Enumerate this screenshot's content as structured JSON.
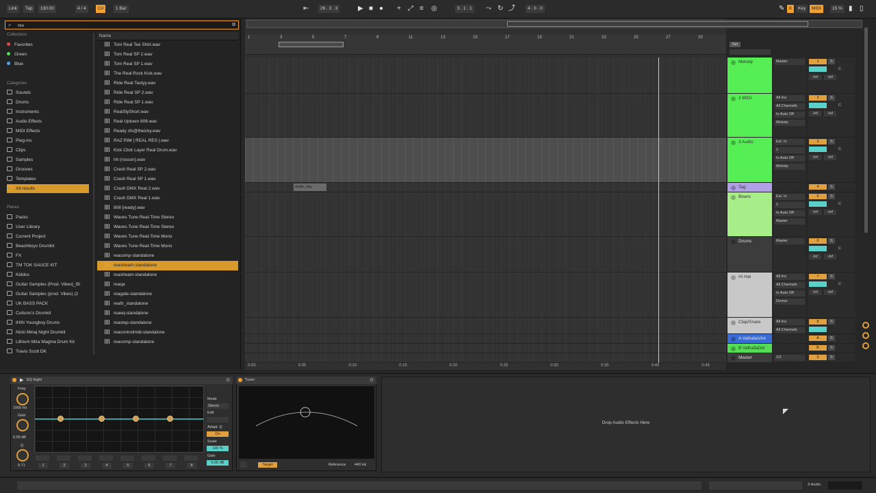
{
  "transport": {
    "link": "Link",
    "tap": "Tap",
    "tempo": "130.00",
    "time_sig": "4 / 4",
    "key_chip": "C#",
    "quantize": "1 Bar",
    "position": "26 . 3 . 3",
    "loop_start": "3 . 1 . 1",
    "loop_length": "4 . 0 . 0",
    "key_btn": "Key",
    "midi_btn": "MIDI",
    "cpu": "15 %"
  },
  "browser": {
    "search_value": "res",
    "collections_head": "Collections",
    "collections": [
      {
        "label": "Favorites",
        "color": "#e04a4a"
      },
      {
        "label": "Green",
        "color": "#5ad85a"
      },
      {
        "label": "Blue",
        "color": "#4aa8e8"
      }
    ],
    "categories_head": "Categories",
    "categories": [
      "Sounds",
      "Drums",
      "Instruments",
      "Audio Effects",
      "MIDI Effects",
      "Plug-ins",
      "Clips",
      "Samples",
      "Grooves",
      "Templates",
      "All results"
    ],
    "places_head": "Places",
    "places": [
      "Packs",
      "User Library",
      "Current Project",
      "Beachboys Drumkit",
      "FX",
      "TM TOK SAUCE KIT",
      "Kiddos",
      "Guitar Samples (Prod. Vibes)_Bl",
      "Guitar Samples (prod. Vibes) (2",
      "UK BASS PACK",
      "Cuttuno's Drumkit",
      "IHIN Youngboy Drums",
      "Nicki Minaj Night Drumkit",
      "Lithium Mira Magma Drum Kit",
      "Travis Scott DK"
    ],
    "name_head": "Name",
    "files": [
      "Tom Real Tee Shirt.wav",
      "Tom Real SP 2.wav",
      "Tom Real SP 1.wav",
      "The Real Rock Kick.wav",
      "Ride Real Tastyy.wav",
      "Ride Real SP 2.wav",
      "Ride Real SP 1.wav",
      "RealSlyShort.wav",
      "Real Uptown 808.wav",
      "Ready sfx@theicky.wav",
      "RAZ RIM | REAL RES |.wav",
      "Kick Click Layer Real Drum.wav",
      "hh (rosson).wav",
      "Crash Real SP 2.wav",
      "Crash Real SP 1.wav",
      "Crash DMX Real 2.wav",
      "Crash DMX Real 1.wav",
      "808 [ready].wav",
      "Waves Tune Real-Time Stereo",
      "Waves Tune Real-Time Stereo",
      "Waves Tune Real-Time Mono",
      "Waves Tune Real-Time Mono",
      "reacomp-standalone",
      "reastream-standalone",
      "reastream-standalone",
      "reaqa",
      "reagate-standalone",
      "reafir_standalone",
      "reaeq-standalone",
      "reastep-standalone",
      "reacontrolmidi-standalone",
      "reacomp-standalone"
    ]
  },
  "arrangement": {
    "bars": [
      "1",
      "3",
      "5",
      "7",
      "9",
      "11",
      "13",
      "15",
      "17",
      "19",
      "21",
      "23",
      "25",
      "27",
      "29"
    ],
    "times": [
      "0:00",
      "0:05",
      "0:10",
      "0:15",
      "0:20",
      "0:25",
      "0:30",
      "0:35",
      "0:40",
      "0:45"
    ],
    "locator": "audio_tag",
    "set_btn": "Set"
  },
  "tracks": [
    {
      "name": "Melody",
      "color": "#55ee55",
      "io": [
        "Master"
      ],
      "vol": "1",
      "pan": "C",
      "peak": "-Inf"
    },
    {
      "name": "2 MIDI",
      "color": "#55ee55",
      "io": [
        "All Ins",
        "All Channels",
        "In Auto Off",
        "Melody"
      ],
      "vol": "2",
      "pan": "C",
      "peak": "-Inf"
    },
    {
      "name": "3 Audio",
      "color": "#55ee55",
      "io": [
        "Ext. In",
        "1",
        "In Auto Off",
        "Melody"
      ],
      "vol": "3",
      "pan": "C",
      "peak": "-Inf"
    },
    {
      "name": "Tag",
      "color": "#b0a0e8",
      "io": [],
      "vol": "4",
      "pan": "",
      "peak": ""
    },
    {
      "name": "Bisers",
      "color": "#a8ee88",
      "io": [
        "Ext. In",
        "1",
        "In Auto Off",
        "Master"
      ],
      "vol": "5",
      "pan": "C",
      "peak": "-Inf"
    },
    {
      "name": "Drums",
      "color": "#3c3c3c",
      "io": [
        "Master"
      ],
      "vol": "6",
      "pan": "C",
      "peak": "-Inf"
    },
    {
      "name": "Hi Hat",
      "color": "#c8c8c8",
      "io": [
        "All Ins",
        "All Channels",
        "In Auto Off",
        "Drums"
      ],
      "vol": "7",
      "pan": "C",
      "peak": "-Inf"
    },
    {
      "name": "Clap/Snare",
      "color": "#c8c8c8",
      "io": [
        "All Ins",
        "All Channels"
      ],
      "vol": "8",
      "pan": "",
      "peak": ""
    },
    {
      "name": "A ValhallaVint",
      "color": "#3a6cd8",
      "io": [],
      "vol": "A",
      "pan": "",
      "peak": ""
    },
    {
      "name": "B ValhallaDel",
      "color": "#55dd55",
      "io": [],
      "vol": "B",
      "pan": "",
      "peak": ""
    },
    {
      "name": "Master",
      "color": "#3c3c3c",
      "io": [
        "1/2"
      ],
      "vol": "0",
      "pan": "",
      "peak": ""
    }
  ],
  "devices": {
    "eq_title": "EQ Eight",
    "freq_label": "Freq",
    "freq_value": "1000 Hz",
    "gain_label": "Gain",
    "gain_value": "0.00 dB",
    "q_label": "Q",
    "q_value": "0.71",
    "mode_label": "Mode",
    "mode_value": "Stereo",
    "edit_label": "Edit",
    "adapt_label": "Adapt. Q",
    "adapt_value": "On",
    "scale_label": "Scale",
    "scale_value": "100 %",
    "outgain_label": "Gain",
    "outgain_value": "0.00 dB",
    "bands": [
      "1",
      "2",
      "3",
      "4",
      "5",
      "6",
      "7",
      "8"
    ],
    "tuner_title": "Tuner",
    "tuner_target": "Target",
    "tuner_reference_label": "Reference",
    "tuner_reference_value": "440 Hz",
    "drop_text": "Drop Audio Effects Here"
  },
  "status": {
    "track_label": "3-Audio"
  },
  "colors": {
    "accent": "#f0a030",
    "track_green": "#55ee55"
  }
}
